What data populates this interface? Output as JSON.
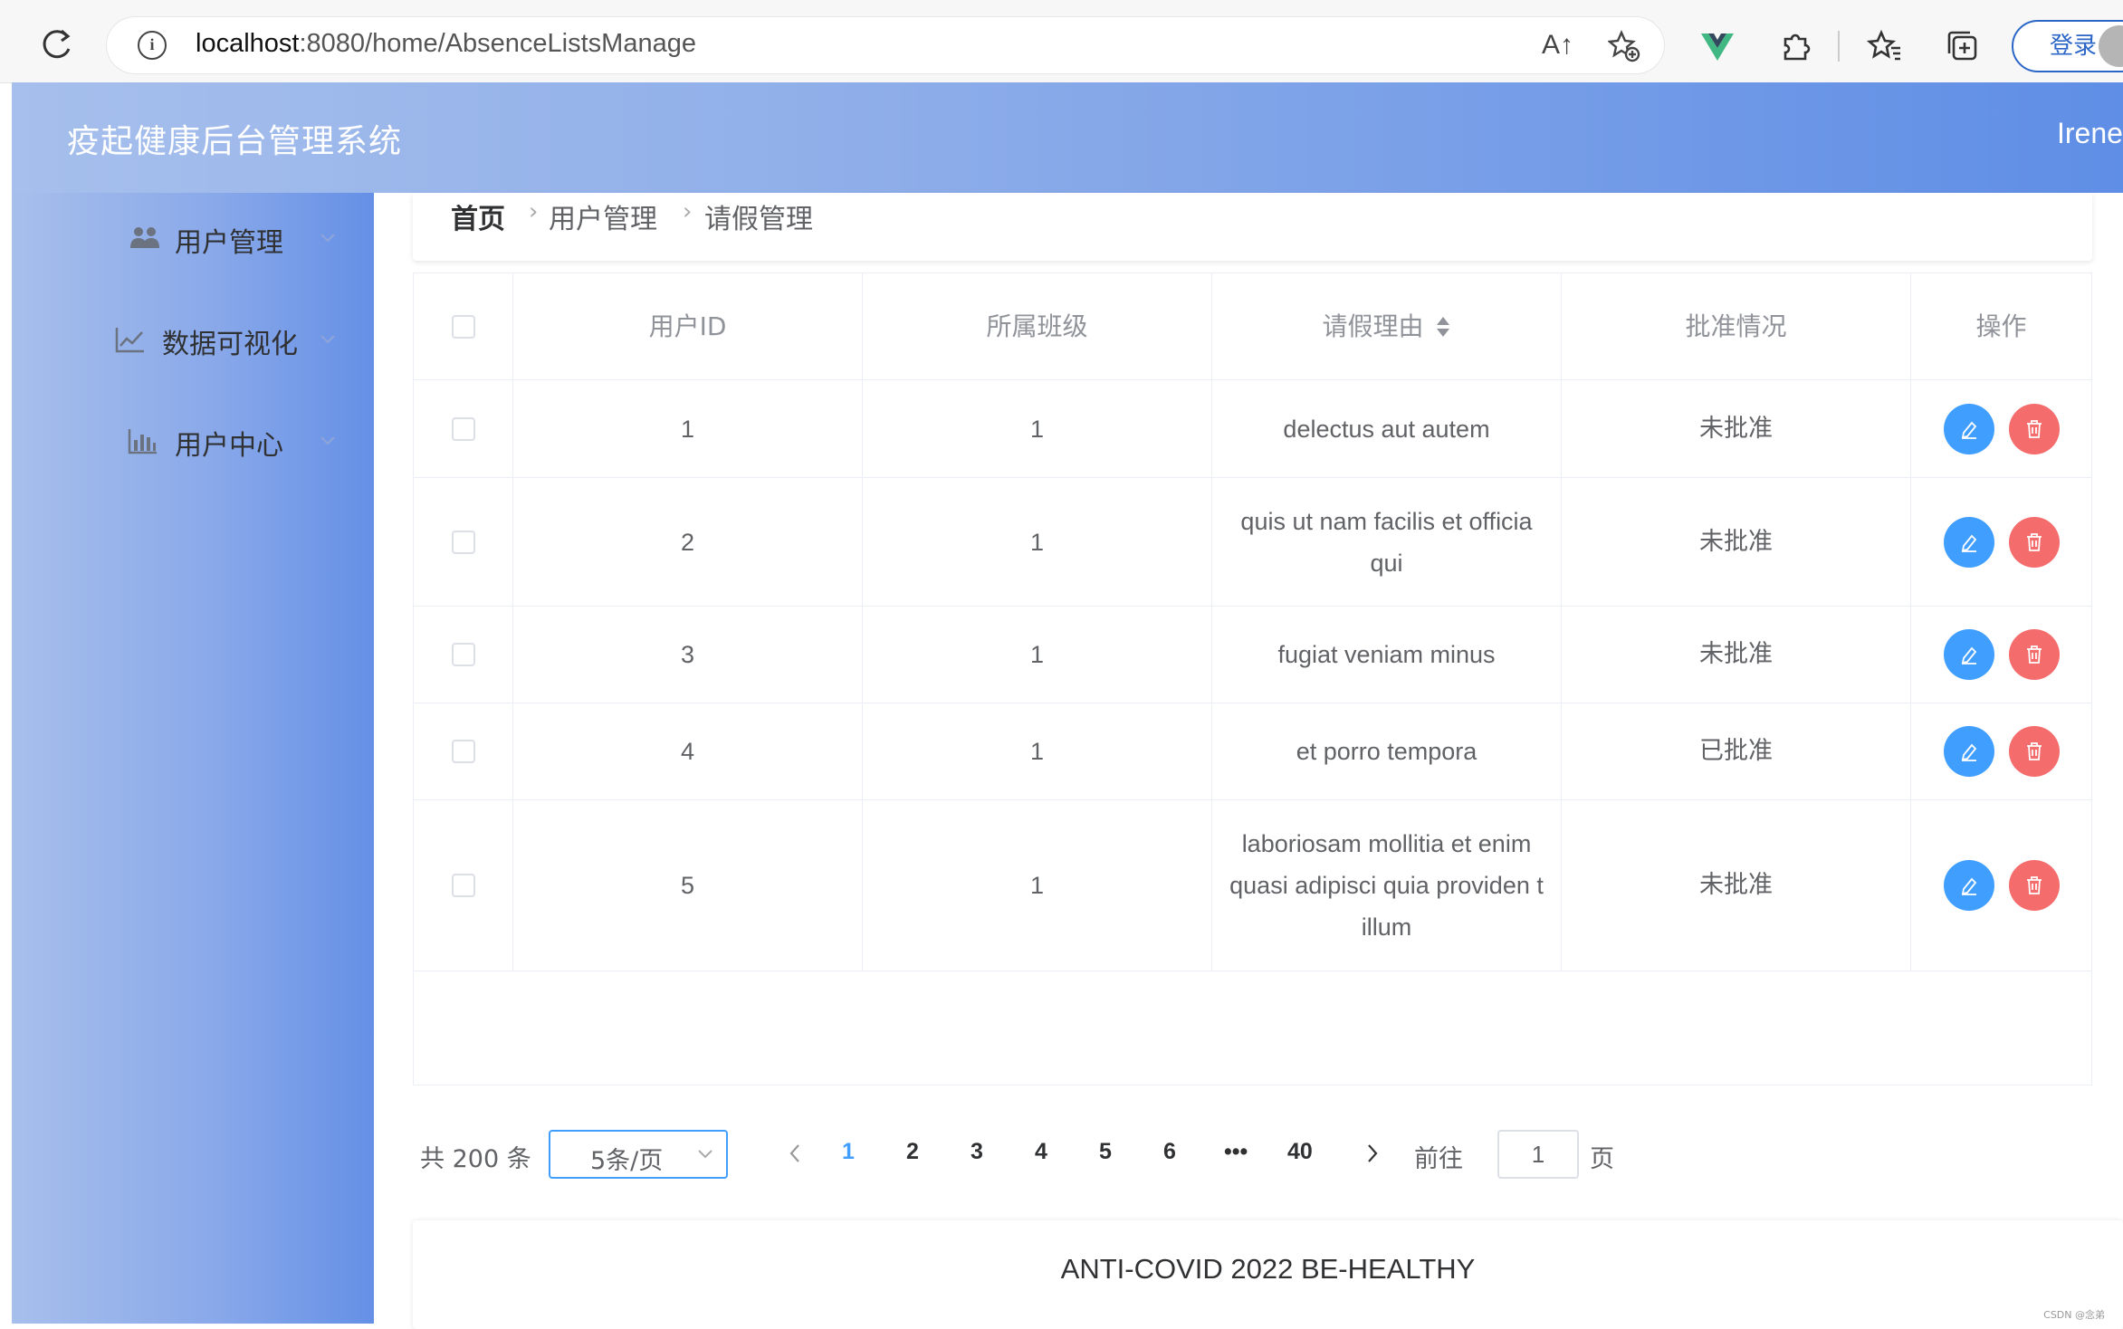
{
  "browser": {
    "url_host": "localhost",
    "url_rest": ":8080/home/AbsenceListsManage",
    "login_label": "登录",
    "read_aloud_label": "A↑"
  },
  "header": {
    "title": "疫起健康后台管理系统",
    "user": "Irene"
  },
  "sidebar": {
    "items": [
      {
        "label": "用户管理",
        "icon": "users-icon"
      },
      {
        "label": "数据可视化",
        "icon": "line-chart-icon"
      },
      {
        "label": "用户中心",
        "icon": "bar-chart-icon"
      }
    ]
  },
  "breadcrumb": {
    "home": "首页",
    "level1": "用户管理",
    "level2": "请假管理"
  },
  "table": {
    "columns": [
      "用户ID",
      "所属班级",
      "请假理由",
      "批准情况",
      "操作"
    ],
    "rows": [
      {
        "id": "1",
        "class": "1",
        "reason": "delectus aut autem",
        "status": "未批准"
      },
      {
        "id": "2",
        "class": "1",
        "reason": "quis ut nam facilis et officia qui",
        "status": "未批准"
      },
      {
        "id": "3",
        "class": "1",
        "reason": "fugiat veniam minus",
        "status": "未批准"
      },
      {
        "id": "4",
        "class": "1",
        "reason": "et porro tempora",
        "status": "已批准"
      },
      {
        "id": "5",
        "class": "1",
        "reason": "laboriosam mollitia et enim quasi adipisci quia providen t illum",
        "status": "未批准"
      }
    ]
  },
  "pagination": {
    "total": "共 200 条",
    "page_size": "5条/页",
    "pages": [
      "1",
      "2",
      "3",
      "4",
      "5",
      "6",
      "•••",
      "40"
    ],
    "current": "1",
    "goto_prefix": "前往",
    "goto_value": "1",
    "goto_suffix": "页"
  },
  "footer": {
    "text": "ANTI-COVID 2022 BE-HEALTHY"
  },
  "watermark": "CSDN @念弟",
  "colors": {
    "primary": "#409eff",
    "danger": "#f56c6c",
    "header_start": "#a6bfec",
    "header_end": "#5f8ee6"
  }
}
